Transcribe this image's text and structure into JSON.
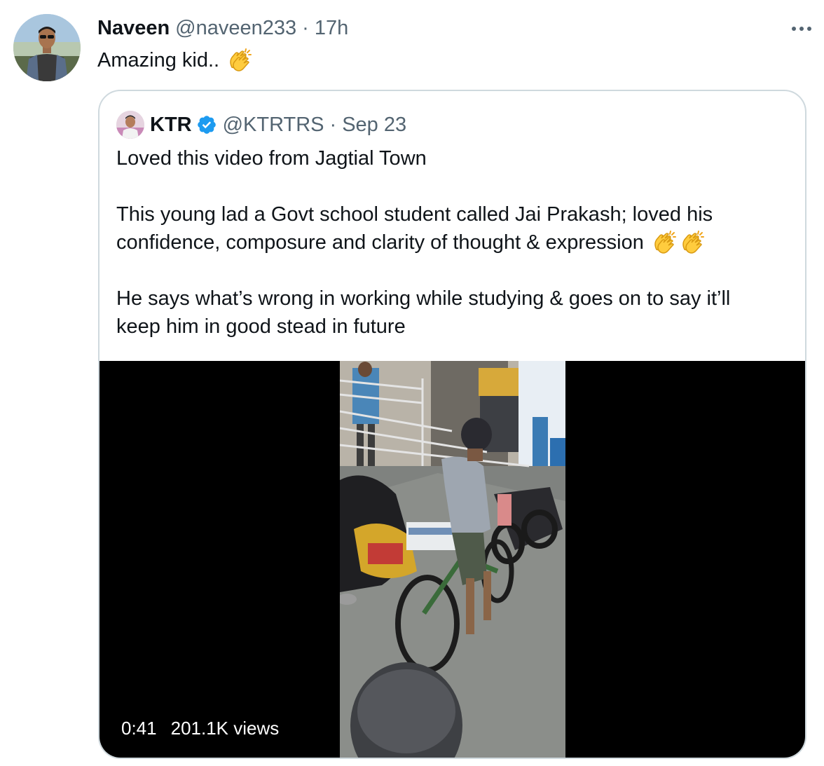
{
  "tweet": {
    "author_name": "Naveen",
    "handle": "@naveen233",
    "separator": "·",
    "time": "17h",
    "text": "Amazing kid.."
  },
  "quoted": {
    "author_name": "KTR",
    "handle": "@KTRTRS",
    "separator": "·",
    "date": "Sep 23",
    "lines": [
      "Loved this video from Jagtial Town",
      "This young lad a Govt school student called Jai Prakash; loved his",
      "confidence, composure and clarity of thought & expression",
      "He says what’s wrong in working while studying & goes on to say it’ll",
      "keep him in good stead in future"
    ],
    "video": {
      "duration": "0:41",
      "views": "201.1K views"
    }
  },
  "icons": {
    "more": "more-icon",
    "verified": "verified-badge-icon",
    "clap": "clapping-hands-icon"
  },
  "colors": {
    "text": "#0f1419",
    "muted": "#536471",
    "border": "#cfd9de",
    "verified": "#1d9bf0"
  }
}
